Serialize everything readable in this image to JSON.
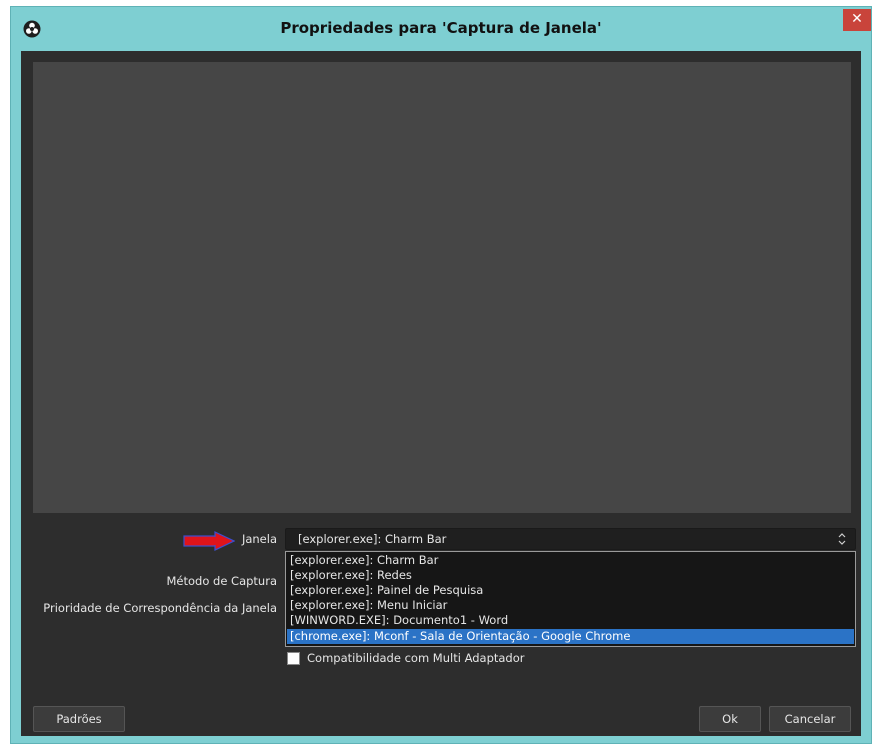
{
  "window": {
    "title": "Propriedades para 'Captura de Janela'",
    "close_glyph": "✕",
    "app_icon": "obs-logo-icon"
  },
  "form": {
    "janela_label": "Janela",
    "metodo_label": "Método de Captura",
    "prioridade_label": "Prioridade de Correspondência da Janela",
    "janela_value": "[explorer.exe]: Charm Bar",
    "options": [
      "[explorer.exe]: Charm Bar",
      "[explorer.exe]: Redes",
      "[explorer.exe]: Painel de Pesquisa",
      "[explorer.exe]: Menu Iniciar",
      "[WINWORD.EXE]: Documento1 - Word",
      "[chrome.exe]: Mconf - Sala de Orientação - Google Chrome"
    ],
    "selected_index": 5,
    "checkbox_label": "Compatibilidade com Multi Adaptador",
    "checkbox_checked": false
  },
  "buttons": {
    "defaults": "Padrões",
    "ok": "Ok",
    "cancel": "Cancelar"
  },
  "colors": {
    "titlebar": "#7ecfd2",
    "arrow": "#e0141b",
    "selection": "#2b73c6"
  }
}
